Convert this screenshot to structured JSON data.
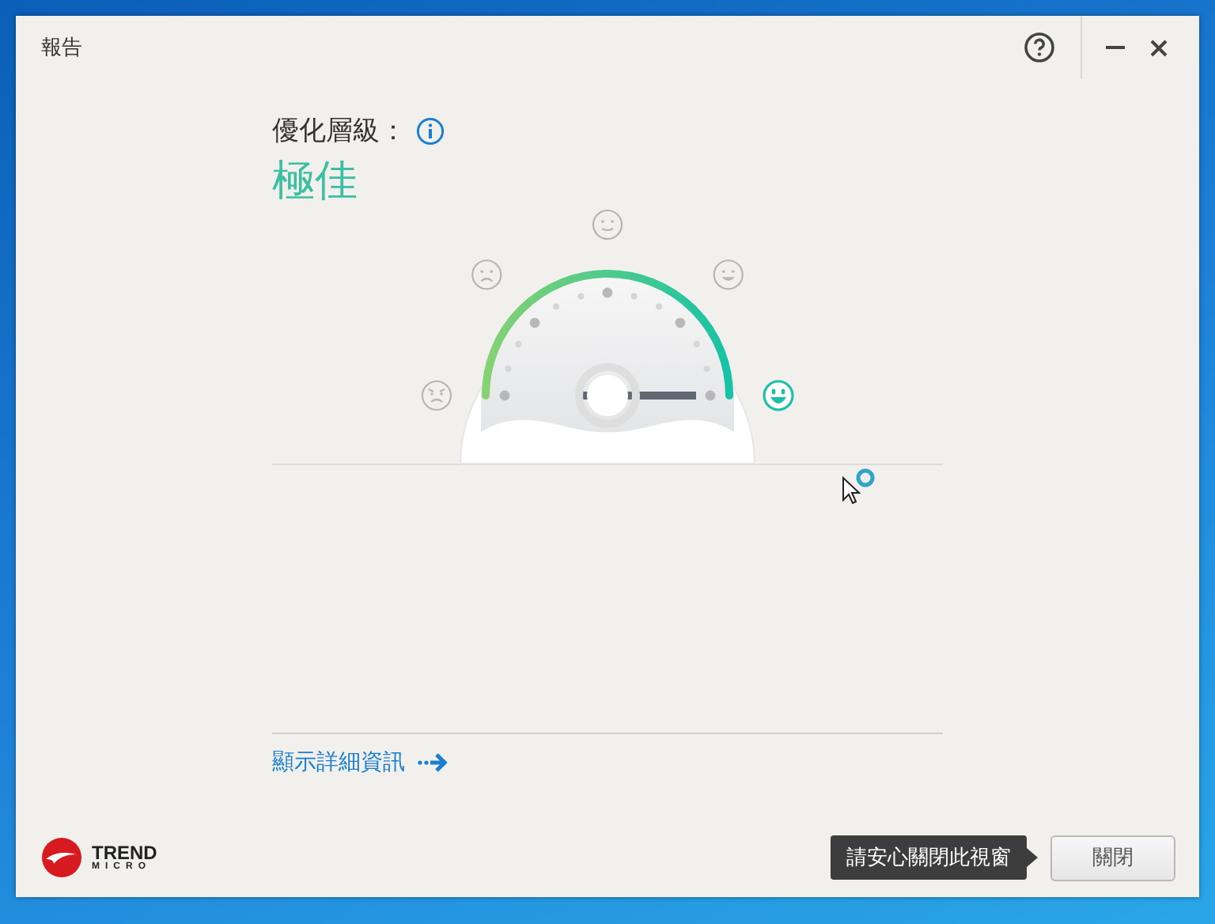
{
  "window": {
    "title": "報告"
  },
  "optimization": {
    "label": "優化層級：",
    "grade": "極佳"
  },
  "gauge": {
    "faces": [
      {
        "kind": "angry",
        "selected": false
      },
      {
        "kind": "sad",
        "selected": false
      },
      {
        "kind": "neutral",
        "selected": false
      },
      {
        "kind": "happy",
        "selected": false
      },
      {
        "kind": "laughing",
        "selected": true
      }
    ]
  },
  "details_link": "顯示詳細資訊",
  "logo": {
    "line_1": "TREND",
    "line_2": "MICRO"
  },
  "tooltip": "請安心關閉此視窗",
  "buttons": [
    "關閉"
  ]
}
